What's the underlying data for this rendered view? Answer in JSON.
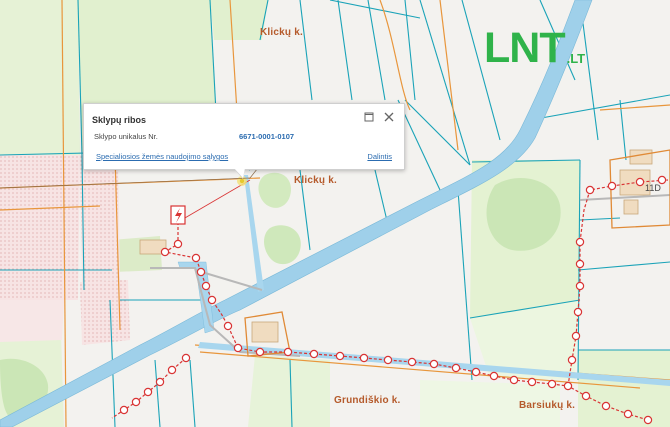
{
  "map": {
    "place_labels": [
      "Klickų k.",
      "Klickų k.",
      "Grundiškio k.",
      "Barsiukų k."
    ],
    "plot_numbers": [
      "11D"
    ],
    "colors": {
      "water": "#9fd0ea",
      "plot_boundary": "#1aa3b8",
      "road": "#e8963c",
      "power_line": "#e03030",
      "forest": "#cbe6b6",
      "pasture": "#e8f3d8",
      "built_up": "#f6dede"
    }
  },
  "logo": {
    "main": "LNT",
    "suffix": ".LT"
  },
  "popup": {
    "title": "Sklypų ribos",
    "label": "Sklypo unikalus Nr.",
    "value": "6671-0001-0107",
    "link": "Specialiosios žemės naudojimo sąlygos",
    "share": "Dalintis"
  },
  "icons": [
    "maximize-icon",
    "close-icon",
    "lightning-icon",
    "location-marker-icon"
  ]
}
